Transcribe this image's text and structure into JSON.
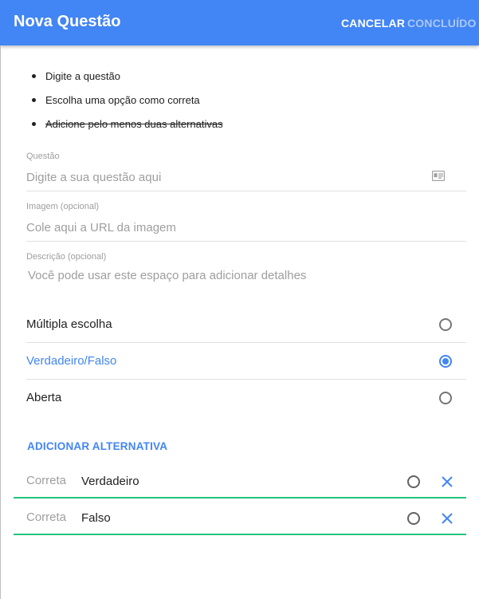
{
  "appbar": {
    "title": "Nova Questão",
    "cancel_label": "CANCELAR",
    "done_label": "CONCLUÍDO"
  },
  "instructions": [
    {
      "text": "Digite a questão",
      "completed": false
    },
    {
      "text": "Escolha uma opção como correta",
      "completed": false
    },
    {
      "text": "Adicione pelo menos duas alternativas",
      "completed": true
    }
  ],
  "fields": {
    "question": {
      "label": "Questão",
      "placeholder": "Digite a sua questão aqui",
      "value": ""
    },
    "image": {
      "label": "Imagem (opcional)",
      "placeholder": "Cole aqui a URL da imagem",
      "value": ""
    },
    "description": {
      "label": "Descrição (opcional)",
      "placeholder": "Você pode usar este espaço para adicionar detalhes",
      "value": ""
    }
  },
  "question_types": [
    {
      "label": "Múltipla escolha",
      "selected": false
    },
    {
      "label": "Verdadeiro/Falso",
      "selected": true
    },
    {
      "label": "Aberta",
      "selected": false
    }
  ],
  "add_alternative_label": "ADICIONAR ALTERNATIVA",
  "alternatives": [
    {
      "correct_label": "Correta",
      "value": "Verdadeiro",
      "correct": false
    },
    {
      "correct_label": "Correta",
      "value": "Falso",
      "correct": false
    }
  ],
  "colors": {
    "primary": "#4285f4",
    "accent_underline": "#21c47b",
    "muted": "#9e9e9e"
  },
  "icons": {
    "question_field": "contact-card-icon",
    "remove_alternative": "close-icon"
  }
}
